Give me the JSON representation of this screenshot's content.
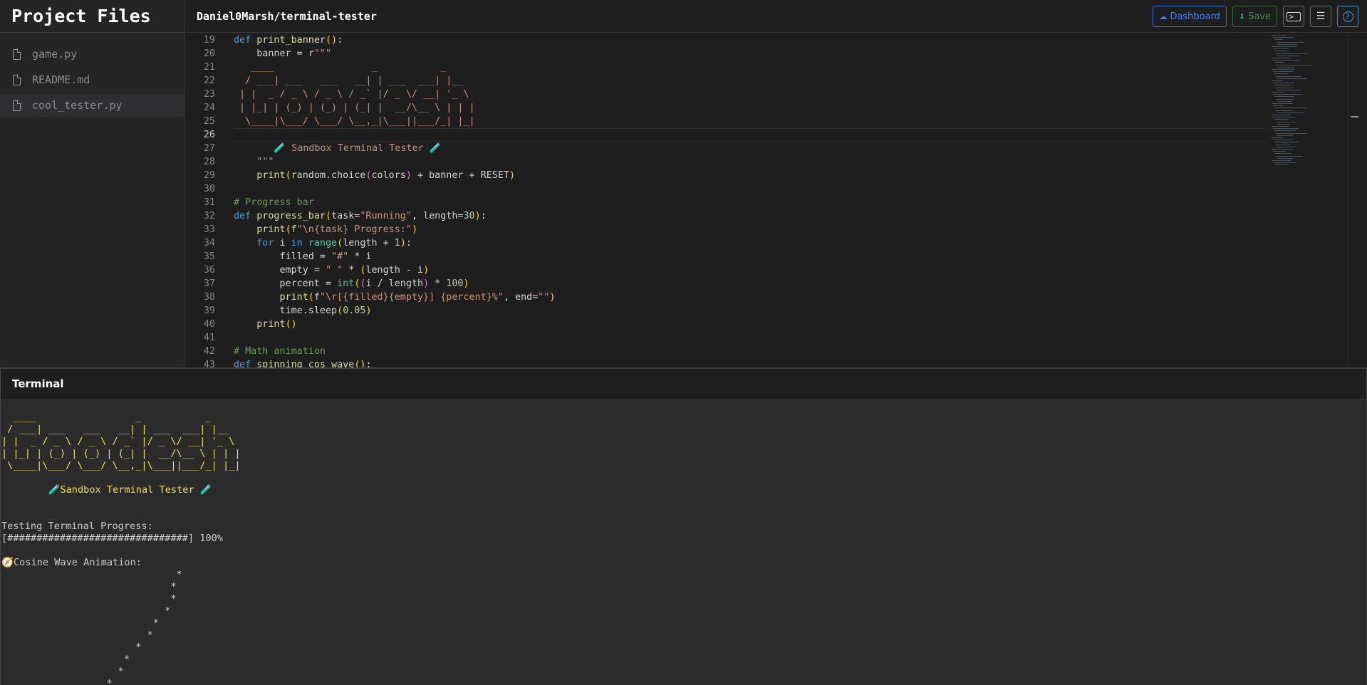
{
  "sidebar": {
    "title": "Project Files",
    "files": [
      {
        "name": "game.py",
        "active": false
      },
      {
        "name": "README.md",
        "active": false
      },
      {
        "name": "cool_tester.py",
        "active": true
      }
    ]
  },
  "header": {
    "repo": "Daniel0Marsh/terminal-tester",
    "dashboard_label": "Dashboard",
    "save_label": "Save",
    "accent_blue": "#3b82f6",
    "accent_green": "#3f8f56"
  },
  "editor": {
    "current_line": 26,
    "lines": [
      {
        "n": "19"
      },
      {
        "n": "20"
      },
      {
        "n": "21"
      },
      {
        "n": "22"
      },
      {
        "n": "23"
      },
      {
        "n": "24"
      },
      {
        "n": "25"
      },
      {
        "n": "26"
      },
      {
        "n": "27"
      },
      {
        "n": "28"
      },
      {
        "n": "29"
      },
      {
        "n": "30"
      },
      {
        "n": "31"
      },
      {
        "n": "32"
      },
      {
        "n": "33"
      },
      {
        "n": "34"
      },
      {
        "n": "35"
      },
      {
        "n": "36"
      },
      {
        "n": "37"
      },
      {
        "n": "38"
      },
      {
        "n": "39"
      },
      {
        "n": "40"
      },
      {
        "n": "41"
      },
      {
        "n": "42"
      },
      {
        "n": "43"
      }
    ],
    "code": {
      "l19_kw": "def",
      "l19_fn": "print_banner",
      "l19_open": "(",
      "l19_close": ")",
      "l19_colon": ":",
      "l20_a": "    banner = r",
      "l20_str": "\"\"\"",
      "ascii": [
        "   ____                 _           _",
        "  / ___| ___   ___   __| | ___  ___| |__",
        " | |  _ / _ \\ / _ \\ / _` |/ _ \\/ __| '_ \\",
        " | |_| | (_) | (_) | (_| |  __/\\__ \\ | | |",
        "  \\____|\\___/ \\___/ \\__,_|\\___||___/_| |_|"
      ],
      "l27": "       🧪 Sandbox Terminal Tester 🧪",
      "l28": "    \"\"\"",
      "l29_print": "print",
      "l29_a": "random.choice",
      "l29_colors": "colors",
      "l29_b": " + banner + RESET",
      "l31": "# Progress bar",
      "l32_kw": "def",
      "l32_fn": "progress_bar",
      "l32_a": "task=",
      "l32_s": "\"Running\"",
      "l32_b": ", length=",
      "l32_n": "30",
      "l32_c": ":",
      "l33_print": "print",
      "l33_f": "f",
      "l33_s": "\"\\n{task} Progress:\"",
      "l34_for": "for",
      "l34_i": " i ",
      "l34_in": "in",
      "l34_range": "range",
      "l34_a": "length + ",
      "l34_n": "1",
      "l34_c": ":",
      "l35_a": "filled = ",
      "l35_s": "\"#\"",
      "l35_b": " * i",
      "l36_a": "empty = ",
      "l36_s": "\" \"",
      "l36_b": " * ",
      "l36_c": "length - i",
      "l37_a": "percent = ",
      "l37_int": "int",
      "l37_b": "i / length",
      "l37_c": " * ",
      "l37_n": "100",
      "l38_print": "print",
      "l38_f": "f",
      "l38_s": "\"\\r[{filled}{empty}] {percent}%\"",
      "l38_b": ", end=",
      "l38_e": "\"\"",
      "l39_a": "time.sleep",
      "l39_n": "0.05",
      "l40_print": "print",
      "l42": "# Math animation",
      "l43_kw": "def",
      "l43_fn": "spinning_cos_wave"
    }
  },
  "terminal": {
    "title": "Terminal",
    "banner": [
      "  ____                 _           _",
      " / ___| ___   ___   __| | ___  ___| |__",
      "| |  _ / _ \\ / _ \\ / _` |/ _ \\/ __| '_ \\",
      "| |_| | (_) | (_) | (_| |  __/\\__ \\ | | |",
      " \\____|\\___/ \\___/ \\__,_|\\___||___/_| |_|"
    ],
    "tagline": "        🧪Sandbox Terminal Tester 🧪",
    "progress_title": "Testing Terminal Progress:",
    "progress_bar": "[###############################] 100%",
    "wave_title": "🧭Cosine Wave Animation:",
    "wave_lines": [
      "                              *",
      "                             *",
      "                             *",
      "                            *",
      "                          *",
      "                         *",
      "                       *",
      "                     *",
      "                    *",
      "                  *"
    ]
  }
}
